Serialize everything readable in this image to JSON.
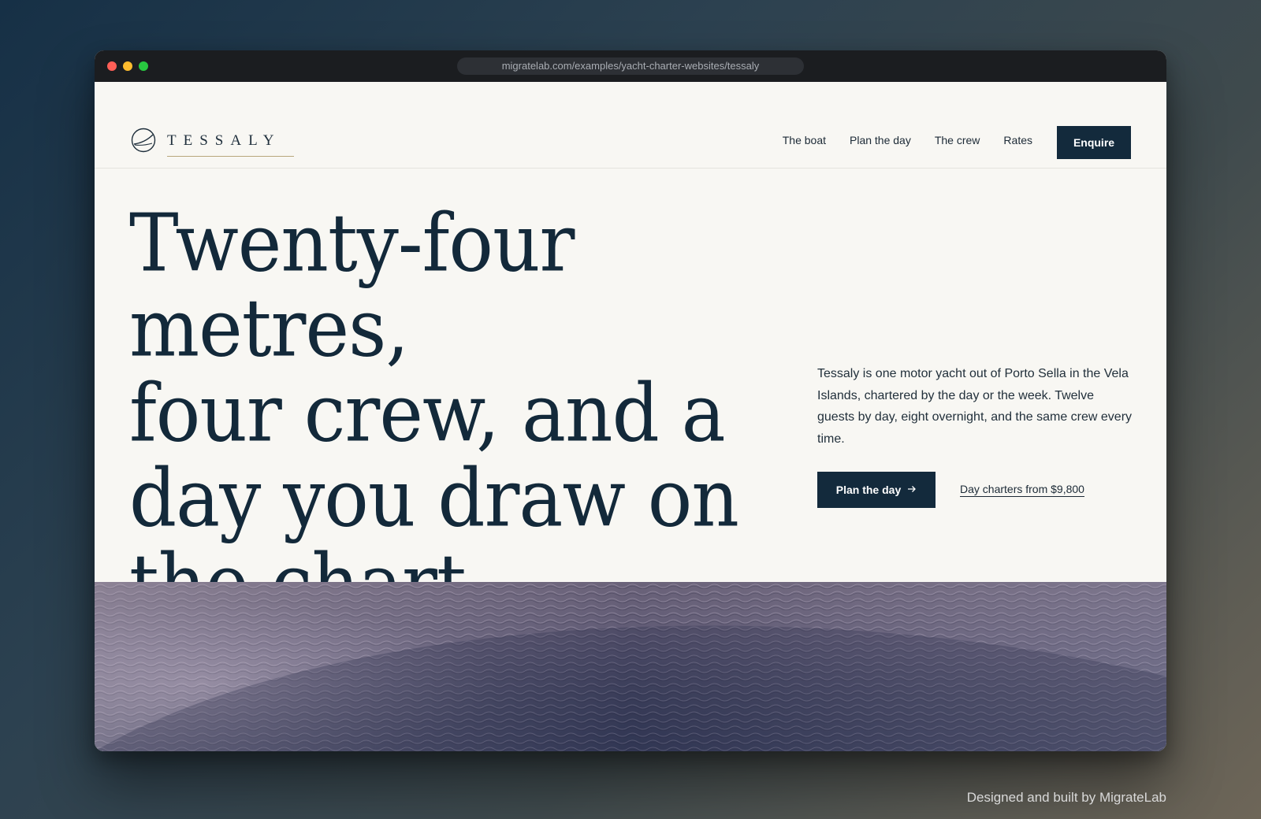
{
  "browser": {
    "url": "migratelab.com/examples/yacht-charter-websites/tessaly"
  },
  "brand": {
    "name": "TESSALY",
    "logo_icon": "sailing-circle-icon"
  },
  "nav": {
    "links": [
      "The boat",
      "Plan the day",
      "The crew",
      "Rates"
    ],
    "enquire_label": "Enquire"
  },
  "hero": {
    "headline_lines": [
      "Twenty-four metres,",
      "four crew, and a",
      "day you draw on",
      "the chart."
    ],
    "description": "Tessaly is one motor yacht out of Porto Sella in the Vela Islands, chartered by the day or the week. Twelve guests by day, eight overnight, and the same crew every time.",
    "primary_cta": "Plan the day",
    "primary_cta_icon": "arrow-right-icon",
    "secondary_cta": "Day charters from $9,800"
  },
  "footer_credit": "Designed and built by MigrateLab",
  "colors": {
    "navy": "#132a3c",
    "page_bg": "#f8f7f3",
    "accent_gold": "#b8a77c"
  }
}
